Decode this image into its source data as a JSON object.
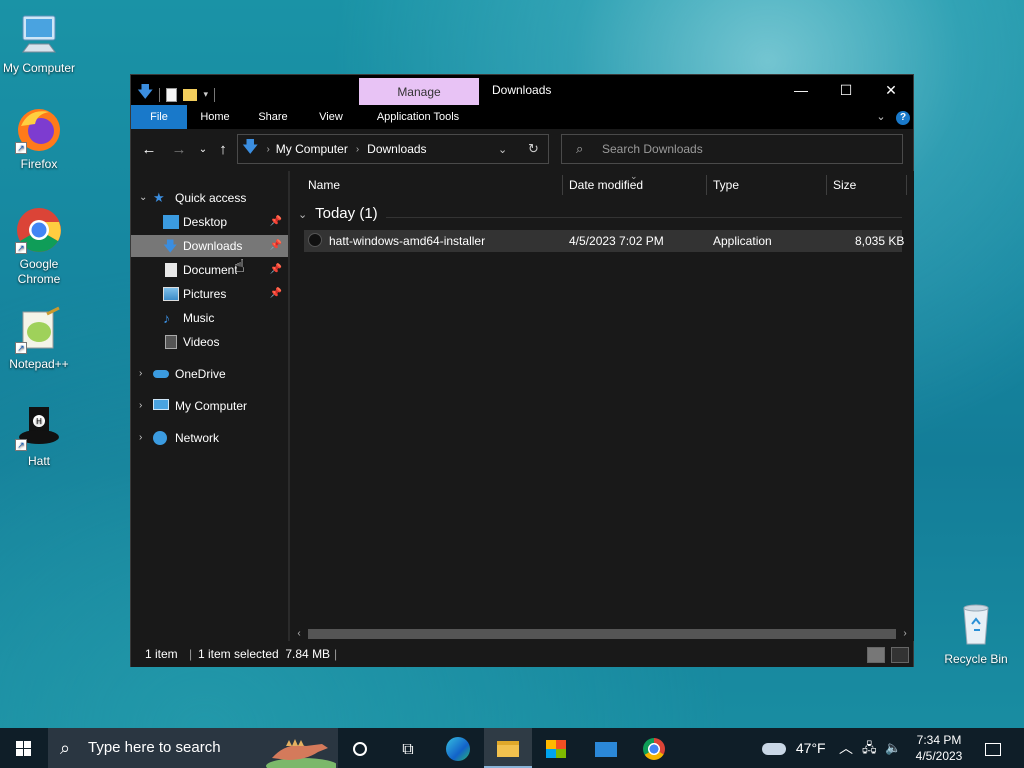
{
  "desktop": {
    "icons": [
      {
        "label": "My Computer",
        "icon": "computer-icon"
      },
      {
        "label": "Firefox",
        "icon": "firefox-icon"
      },
      {
        "label": "Google Chrome",
        "icon": "chrome-icon"
      },
      {
        "label": "Notepad++",
        "icon": "notepadpp-icon"
      },
      {
        "label": "Hatt",
        "icon": "hatt-icon"
      }
    ],
    "recycle_bin": "Recycle Bin"
  },
  "window": {
    "title": "Downloads",
    "manage_tab": "Manage",
    "ribbon_tabs": [
      "File",
      "Home",
      "Share",
      "View",
      "Application Tools"
    ],
    "breadcrumb": [
      "My Computer",
      "Downloads"
    ],
    "search_placeholder": "Search Downloads",
    "nav": {
      "quick_access": "Quick access",
      "items": [
        {
          "label": "Desktop",
          "pinned": true
        },
        {
          "label": "Downloads",
          "pinned": true,
          "selected": true
        },
        {
          "label": "Documents",
          "pinned": true
        },
        {
          "label": "Pictures",
          "pinned": true
        },
        {
          "label": "Music",
          "pinned": false
        },
        {
          "label": "Videos",
          "pinned": false
        }
      ],
      "roots": [
        "OneDrive",
        "My Computer",
        "Network"
      ]
    },
    "columns": [
      "Name",
      "Date modified",
      "Type",
      "Size"
    ],
    "group": "Today (1)",
    "files": [
      {
        "name": "hatt-windows-amd64-installer",
        "date": "4/5/2023 7:02 PM",
        "type": "Application",
        "size": "8,035 KB"
      }
    ],
    "status": {
      "count": "1 item",
      "selection": "1 item selected  7.84 MB"
    }
  },
  "taskbar": {
    "search_placeholder": "Type here to search",
    "weather": "47°F",
    "time": "7:34 PM",
    "date": "4/5/2023"
  },
  "colors": {
    "file_tab": "#1979ca",
    "manage_tab": "#e8c3f5",
    "window_bg": "#191919",
    "taskbar": "#0f1e28"
  }
}
